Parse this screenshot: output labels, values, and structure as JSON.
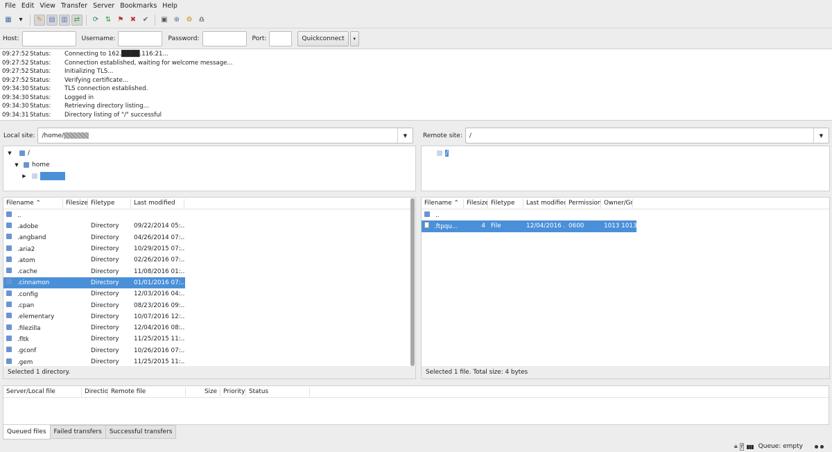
{
  "menu": [
    "File",
    "Edit",
    "View",
    "Transfer",
    "Server",
    "Bookmarks",
    "Help"
  ],
  "quickconnect": {
    "host_label": "Host:",
    "username_label": "Username:",
    "password_label": "Password:",
    "port_label": "Port:",
    "host_value": "",
    "username_value": "",
    "password_value": "",
    "port_value": "",
    "button_label": "Quickconnect"
  },
  "log": [
    {
      "time": "09:27:52",
      "kind": "Status:",
      "msg": "Connecting to 162.████.116:21..."
    },
    {
      "time": "09:27:52",
      "kind": "Status:",
      "msg": "Connection established, waiting for welcome message..."
    },
    {
      "time": "09:27:52",
      "kind": "Status:",
      "msg": "Initializing TLS..."
    },
    {
      "time": "09:27:52",
      "kind": "Status:",
      "msg": "Verifying certificate..."
    },
    {
      "time": "09:34:30",
      "kind": "Status:",
      "msg": "TLS connection established."
    },
    {
      "time": "09:34:30",
      "kind": "Status:",
      "msg": "Logged in"
    },
    {
      "time": "09:34:30",
      "kind": "Status:",
      "msg": "Retrieving directory listing..."
    },
    {
      "time": "09:34:31",
      "kind": "Status:",
      "msg": "Directory listing of \"/\" successful"
    }
  ],
  "local": {
    "label": "Local site:",
    "path": "/home/",
    "tree": [
      "/",
      "home"
    ],
    "columns": [
      "Filename",
      "Filesize",
      "Filetype",
      "Last modified"
    ],
    "files": [
      {
        "name": "..",
        "size": "",
        "type": "",
        "modified": ""
      },
      {
        "name": ".adobe",
        "size": "",
        "type": "Directory",
        "modified": "09/22/2014 05:..."
      },
      {
        "name": ".angband",
        "size": "",
        "type": "Directory",
        "modified": "04/26/2014 07:..."
      },
      {
        "name": ".aria2",
        "size": "",
        "type": "Directory",
        "modified": "10/29/2015 07:..."
      },
      {
        "name": ".atom",
        "size": "",
        "type": "Directory",
        "modified": "02/26/2016 07:..."
      },
      {
        "name": ".cache",
        "size": "",
        "type": "Directory",
        "modified": "11/08/2016 01:..."
      },
      {
        "name": ".cinnamon",
        "size": "",
        "type": "Directory",
        "modified": "01/01/2016 07:..."
      },
      {
        "name": ".config",
        "size": "",
        "type": "Directory",
        "modified": "12/03/2016 04:..."
      },
      {
        "name": ".cpan",
        "size": "",
        "type": "Directory",
        "modified": "08/23/2016 09:..."
      },
      {
        "name": ".elementary",
        "size": "",
        "type": "Directory",
        "modified": "10/07/2016 12:..."
      },
      {
        "name": ".filezilla",
        "size": "",
        "type": "Directory",
        "modified": "12/04/2016 08:..."
      },
      {
        "name": ".fltk",
        "size": "",
        "type": "Directory",
        "modified": "11/25/2015 11:..."
      },
      {
        "name": ".gconf",
        "size": "",
        "type": "Directory",
        "modified": "10/26/2016 07:..."
      },
      {
        "name": ".gem",
        "size": "",
        "type": "Directory",
        "modified": "11/25/2015 11:..."
      }
    ],
    "selected_index": 6,
    "status": "Selected 1 directory."
  },
  "remote": {
    "label": "Remote site:",
    "path": "/",
    "tree": [
      "/"
    ],
    "columns": [
      "Filename",
      "Filesize",
      "Filetype",
      "Last modified",
      "Permissions",
      "Owner/Grou"
    ],
    "files": [
      {
        "name": "..",
        "size": "",
        "type": "",
        "modified": "",
        "perms": "",
        "owner": ""
      },
      {
        "name": ".ftpqu...",
        "size": "4",
        "type": "File",
        "modified": "12/04/2016 ...",
        "perms": "0600",
        "owner": "1013 1013"
      }
    ],
    "status": "Selected 1 file. Total size: 4 bytes"
  },
  "queue": {
    "columns": [
      "Server/Local file",
      "Directio",
      "Remote file",
      "Size",
      "Priority",
      "Status"
    ],
    "tabs": [
      "Queued files",
      "Failed transfers",
      "Successful transfers"
    ],
    "status": "Queue: empty"
  },
  "colors": {
    "selection": "#4a90d9",
    "folder": "#6b93d4"
  }
}
